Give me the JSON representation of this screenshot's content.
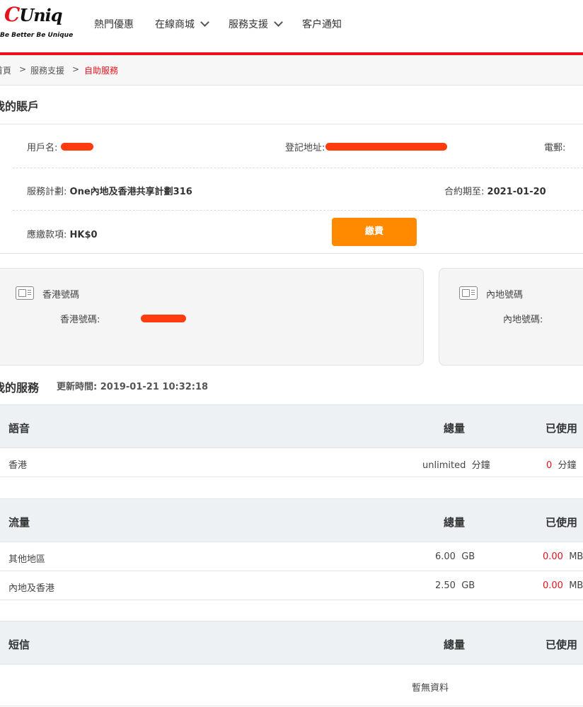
{
  "brand": {
    "logo_text": "CUniq",
    "tagline": "Be Better Be Unique",
    "accent_color": "#e8121d",
    "button_color": "#ff8a00"
  },
  "nav": {
    "items": [
      {
        "label": "熱門優惠",
        "has_dropdown": false
      },
      {
        "label": "在線商城",
        "has_dropdown": true
      },
      {
        "label": "服務支援",
        "has_dropdown": true
      },
      {
        "label": "客户通知",
        "has_dropdown": false
      }
    ]
  },
  "breadcrumb": {
    "items": [
      "首頁",
      "服務支援",
      "自助服務"
    ],
    "separator": ">"
  },
  "account": {
    "title": "我的賬戶",
    "username_label": "用戶名:",
    "address_label": "登記地址:",
    "email_label": "電郵:",
    "plan_label": "服務計劃:",
    "plan_value": "One內地及香港共享計劃316",
    "contract_label": "合約期至:",
    "contract_value": "2021-01-20",
    "due_label": "應繳款項:",
    "due_value": "HK$0",
    "pay_button": "繳費"
  },
  "numbers": {
    "hk": {
      "title": "香港號碼",
      "label": "香港號碼:"
    },
    "cn": {
      "title": "內地號碼",
      "label": "內地號碼:"
    }
  },
  "services": {
    "title": "我的服務",
    "update_label": "更新時間:",
    "update_time": "2019-01-21 10:32:18",
    "total_header": "總量",
    "used_header": "已使用",
    "voice": {
      "title": "語音",
      "rows": [
        {
          "name": "香港",
          "total": "unlimited",
          "total_unit": "分鐘",
          "used": "0",
          "used_unit": "分鐘"
        }
      ]
    },
    "data": {
      "title": "流量",
      "rows": [
        {
          "name": "其他地區",
          "total": "6.00",
          "total_unit": "GB",
          "used": "0.00",
          "used_unit": "MB"
        },
        {
          "name": "內地及香港",
          "total": "2.50",
          "total_unit": "GB",
          "used": "0.00",
          "used_unit": "MB"
        }
      ]
    },
    "sms": {
      "title": "短信",
      "empty_text": "暫無資料"
    }
  }
}
